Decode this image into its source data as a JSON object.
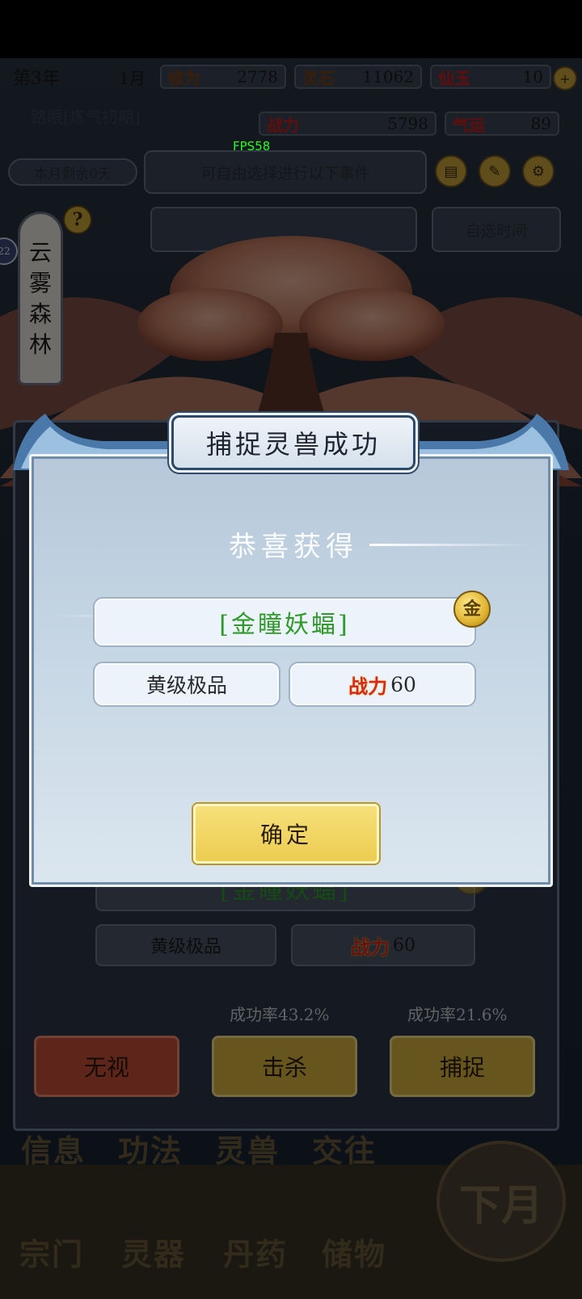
{
  "fps": "FPS58",
  "topbar": {
    "year": "第3年",
    "month": "1月",
    "xiuwei_label": "修为",
    "xiuwei_value": "2778",
    "lingshi_label": "灵石",
    "lingshi_value": "11062",
    "xianyu_label": "仙玉",
    "xianyu_value": "10",
    "title_text": "路眼[炼气初期]",
    "zhanli_label": "战力",
    "zhanli_value": "5798",
    "qiyun_label": "气运",
    "qiyun_value": "89",
    "month_remaining": "本月剩余0天",
    "event_hint": "可自由选择进行以下事件",
    "side_badge": "22"
  },
  "location": {
    "chars": [
      "云",
      "雾",
      "森",
      "林"
    ],
    "help": "?"
  },
  "bg_tabs": [
    "自选时间"
  ],
  "modal": {
    "title": "捕捉灵兽成功",
    "subtitle": "恭喜获得",
    "beast_name": "[金瞳妖蝠]",
    "coin_label": "金",
    "grade": "黄级极品",
    "power_label": "战力",
    "power_value": "60",
    "confirm": "确定"
  },
  "bg_panel": {
    "beast_name": "[金瞳妖蝠]",
    "coin_label": "金",
    "grade": "黄级极品",
    "power_label": "战力",
    "power_value": "60",
    "rate_kill": "成功率43.2%",
    "rate_capture": "成功率21.6%",
    "btn_ignore": "无视",
    "btn_kill": "击杀",
    "btn_capture": "捕捉"
  },
  "bottom_nav": {
    "row1": [
      "信息",
      "功法",
      "灵兽",
      "交往"
    ],
    "row2": [
      "宗门",
      "灵器",
      "丹药",
      "储物"
    ],
    "next_month": "下月"
  },
  "colors": {
    "green_name": "#2f9a2a",
    "power_red": "#d6281e",
    "gold_button": "#eccd52"
  }
}
